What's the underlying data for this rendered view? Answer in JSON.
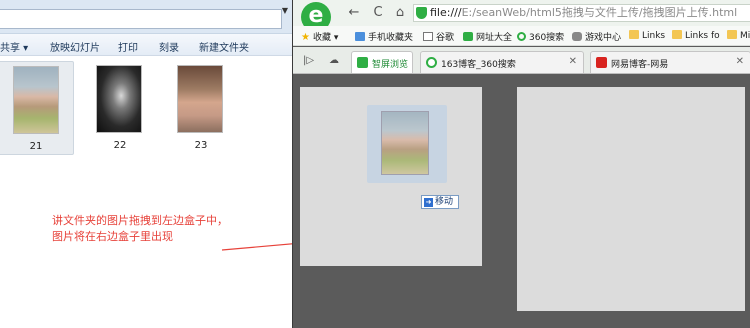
{
  "explorer": {
    "toolbar": {
      "share": "共享 ▾",
      "slideshow": "放映幻灯片",
      "print": "打印",
      "burn": "刻录",
      "new_folder": "新建文件夹"
    },
    "files": [
      {
        "name": "21",
        "selected": true
      },
      {
        "name": "22",
        "selected": false
      },
      {
        "name": "23",
        "selected": false
      }
    ]
  },
  "annotation": {
    "line1": "讲文件夹的图片拖拽到左边盒子中，",
    "line2": "图片将在右边盒子里出现",
    "color": "#e7423a"
  },
  "browser": {
    "logo_letter": "e",
    "nav": {
      "back": "←",
      "refresh": "C",
      "home": "⌂"
    },
    "url": {
      "scheme": "file:///",
      "path": "E:/seanWeb/html5拖拽与文件上传/拖拽图片上传.html"
    },
    "bookmarks": [
      {
        "label": "收藏 ▾",
        "icon": "star-icon"
      },
      {
        "label": "手机收藏夹",
        "icon": "phone-icon"
      },
      {
        "label": "谷歌",
        "icon": "document-icon"
      },
      {
        "label": "网址大全",
        "icon": "green-shield-icon"
      },
      {
        "label": "360搜索",
        "icon": "360-icon"
      },
      {
        "label": "游戏中心",
        "icon": "gamepad-icon"
      },
      {
        "label": "Links",
        "icon": "folder-icon"
      },
      {
        "label": "Links fo",
        "icon": "folder-icon"
      },
      {
        "label": "Mi",
        "icon": "folder-icon"
      }
    ],
    "tabs": [
      {
        "label": "智屏浏览",
        "active": true
      },
      {
        "label": "163博客_360搜索",
        "active": false
      },
      {
        "label": "网易博客-网易",
        "active": false
      }
    ],
    "page": {
      "move_tooltip": "移动"
    }
  },
  "colors": {
    "page_bg": "#5b5b5b",
    "box_bg": "#dcdcdc",
    "brand_green": "#2fae44"
  }
}
